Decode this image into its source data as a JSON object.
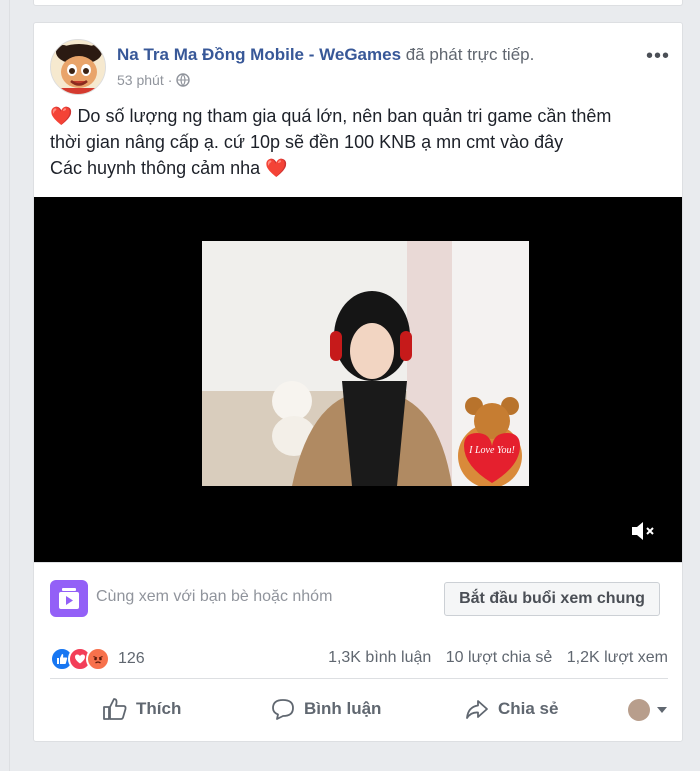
{
  "post": {
    "author_name": "Na Tra Ma Đồng Mobile - WeGames",
    "author_action": "đã phát trực tiếp.",
    "time": "53 phút",
    "time_sep": "·",
    "more_label": "•••",
    "text_heart": "❤️",
    "text_line1": "Do số lượng ng tham gia quá lớn, nên ban quản tri game cần thêm",
    "text_line2": "thời gian nâng cấp ạ. cứ 10p sẽ đền 100 KNB ạ mn cmt vào đây",
    "text_line3": "Các huynh thông cảm nha"
  },
  "video": {
    "overlay_text": "I Love You!",
    "mute_icon": "speaker-muted-icon"
  },
  "watch_party": {
    "description": "Cùng xem với bạn bè hoặc nhóm",
    "button_label": "Bắt đầu buổi xem chung"
  },
  "stats": {
    "reaction_count": "126",
    "comments": "1,3K bình luận",
    "shares": "10 lượt chia sẻ",
    "views": "1,2K lượt xem"
  },
  "actions": {
    "like": "Thích",
    "comment": "Bình luận",
    "share": "Chia sẻ"
  },
  "colors": {
    "link": "#385898",
    "like_blue": "#1877f2",
    "love_red": "#f33e58",
    "angry_orange": "#f7714c",
    "watch_purple": "#9360f7"
  }
}
